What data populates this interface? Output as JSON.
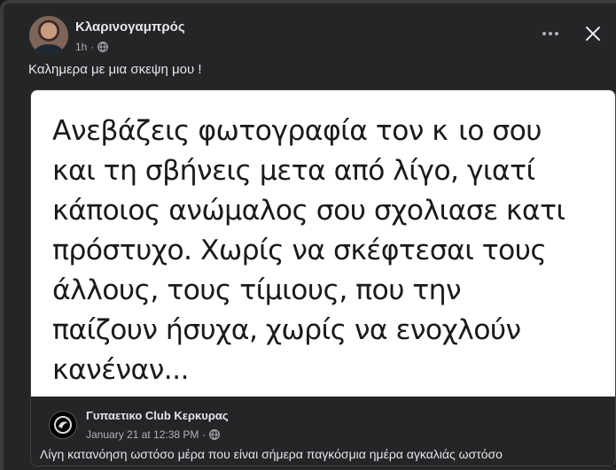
{
  "post": {
    "author": "Κλαρινογαμπρός",
    "time": "1h",
    "time_separator": "·",
    "caption": "Καλημερα με μια σκεψη μου !",
    "icons": {
      "privacy": "globe-icon",
      "more": "more-options-icon",
      "close": "close-icon"
    }
  },
  "shared": {
    "image_lines": [
      "Ανεβάζεις φωτογραφία τον κ  ιο σου",
      "και τη σβήνεις μετα από λίγο, γιατί",
      "κάποιος ανώμαλος σου σχολιασε κατι",
      "πρόστυχο. Χωρίς να σκέφτεσαι τους",
      "άλλους, τους τίμιους, που την",
      "παίζουν ήσυχα, χωρίς να ενοχλούν",
      "κανέναν..."
    ],
    "page_name": "Γυπαετικο Club Κερκυρας",
    "date": "January 21 at 12:38 PM",
    "date_separator": "·",
    "caption": "Λίγη κατανόηση ωστόσο μέρα που είναι σήμερα παγκόσμια ημέρα αγκαλιάς ωστόσο"
  },
  "colors": {
    "background": "#242526",
    "text_primary": "#e4e6eb",
    "text_secondary": "#b0b3b8",
    "image_background": "#ffffff"
  }
}
